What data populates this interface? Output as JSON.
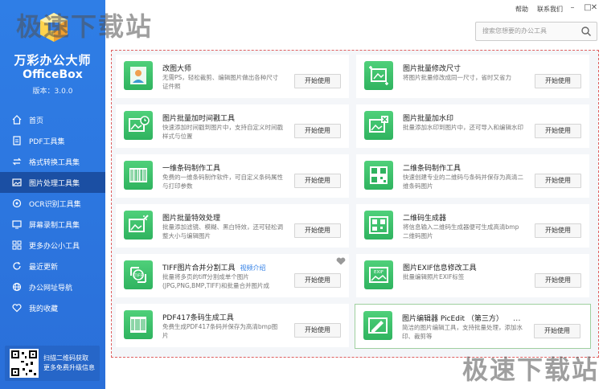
{
  "sidebar": {
    "brand_cn": "万彩办公大师",
    "brand_en": "OfficeBox",
    "version": "版本：3.0.0",
    "items": [
      {
        "label": "首页",
        "icon": "home-icon"
      },
      {
        "label": "PDF工具集",
        "icon": "pdf-icon"
      },
      {
        "label": "格式转换工具集",
        "icon": "convert-icon"
      },
      {
        "label": "图片处理工具集",
        "icon": "image-icon",
        "active": true
      },
      {
        "label": "OCR识别工具集",
        "icon": "ocr-icon"
      },
      {
        "label": "屏幕录制工具集",
        "icon": "screen-record-icon"
      },
      {
        "label": "更多办公小工具",
        "icon": "grid-icon"
      },
      {
        "label": "最近更新",
        "icon": "refresh-icon"
      },
      {
        "label": "办公网址导航",
        "icon": "globe-icon"
      },
      {
        "label": "我的收藏",
        "icon": "heart-icon"
      }
    ],
    "qr_line1": "扫描二维码获取",
    "qr_line2": "更多免费升级信息"
  },
  "topbar": {
    "help": "帮助",
    "contact": "联系我们",
    "search_placeholder": "搜索您想要的办公工具"
  },
  "tools": [
    {
      "title": "改图大师",
      "desc": "无需PS，轻松裁剪、编辑图片做出各种尺寸证件照",
      "button": "开始使用"
    },
    {
      "title": "图片批量修改尺寸",
      "desc": "将图片批量修改成同一尺寸，省时又省力",
      "button": "开始使用"
    },
    {
      "title": "图片批量加时间戳工具",
      "desc": "快速添加时间戳到图片中，支持自定义时间戳样式与位置",
      "button": "开始使用"
    },
    {
      "title": "图片批量加水印",
      "desc": "批量添加水印到图片中，还可导入和编辑水印",
      "button": "开始使用"
    },
    {
      "title": "一维条码制作工具",
      "desc": "免费的一维条码制作软件，可自定义条码属性与打印参数",
      "button": "开始使用"
    },
    {
      "title": "二维条码制作工具",
      "desc": "快速创建专业的二维码与条码并保存为高清二维条码图片",
      "button": "开始使用"
    },
    {
      "title": "图片批量特效处理",
      "desc": "批量添加滤镜、模糊、黑白特效，还可轻松调整大小与编辑图片",
      "button": "开始使用"
    },
    {
      "title": "二维码生成器",
      "desc": "将信息输入二维码生成器便可生成高清bmp二维码图片",
      "button": "开始使用"
    },
    {
      "title": "TIFF图片合并分割工具",
      "link": "视频介绍",
      "desc": "批量将多页的tiff分割成单个图片(JPG,PNG,BMP,TIFF)和批量合并图片成",
      "button": "开始使用"
    },
    {
      "title": "图片EXIF信息修改工具",
      "desc": "批量编辑照片EXIF标签",
      "button": "开始使用"
    },
    {
      "title": "PDF417条码生成工具",
      "desc": "免费生成PDF417条码并保存为高清bmp图片",
      "button": "开始使用"
    },
    {
      "title": "图片编辑器 PicEdit （第三方）",
      "desc": "简洁的图片编辑工具，支持批量处理，添加水印、裁剪等",
      "button": "开始使用",
      "more": "..."
    }
  ],
  "watermark": "极速下载站"
}
